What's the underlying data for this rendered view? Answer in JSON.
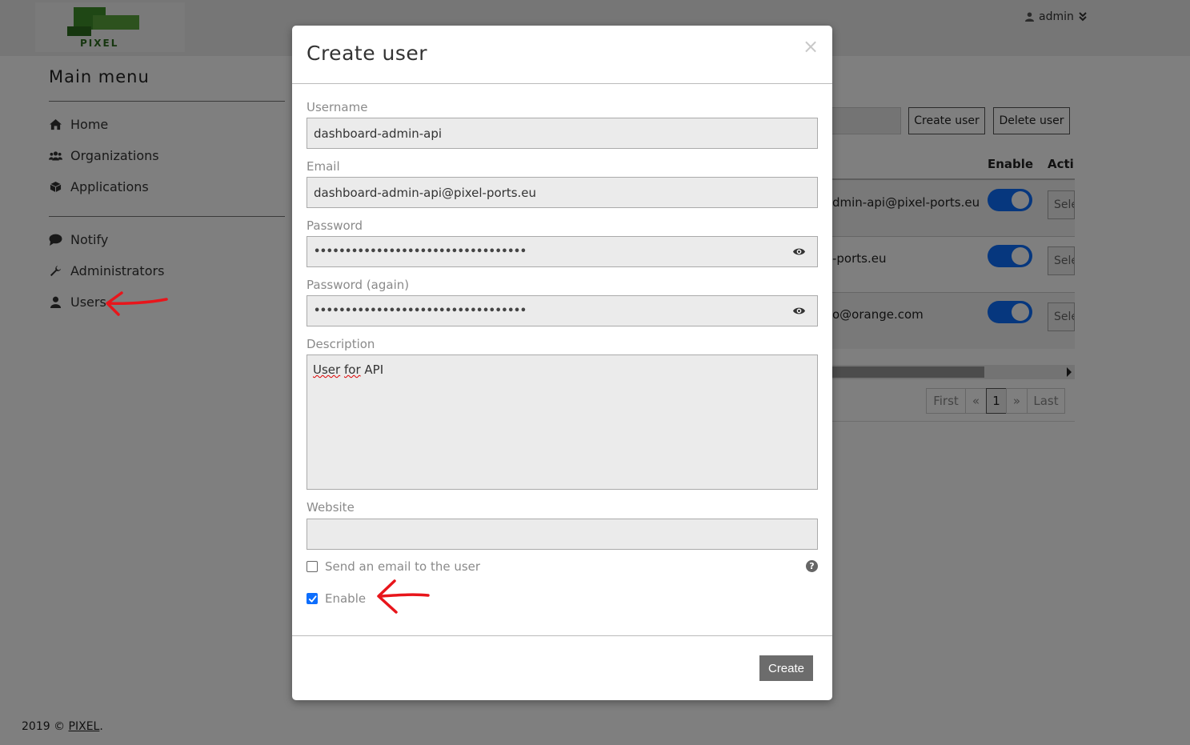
{
  "header": {
    "logo_text": "PIXEL",
    "user_label": "admin"
  },
  "main_menu": {
    "title": "Main menu",
    "items": [
      {
        "label": "Home",
        "icon": "home-icon"
      },
      {
        "label": "Organizations",
        "icon": "users-group-icon"
      },
      {
        "label": "Applications",
        "icon": "cube-icon"
      },
      {
        "label": "Notify",
        "icon": "comment-icon"
      },
      {
        "label": "Administrators",
        "icon": "wrench-icon"
      },
      {
        "label": "Users",
        "icon": "user-icon"
      }
    ]
  },
  "background_table": {
    "create_user_label": "Create user",
    "delete_user_label": "Delete user",
    "col_enable": "Enable",
    "col_actions": "Acti",
    "rows": [
      {
        "email": "dmin-api@pixel-ports.eu",
        "enabled": true,
        "select": "Sele"
      },
      {
        "email": "-ports.eu",
        "enabled": true,
        "select": "Sele"
      },
      {
        "email": "o@orange.com",
        "enabled": true,
        "select": "Sele"
      }
    ],
    "pager": {
      "first": "First",
      "prev": "«",
      "page": "1",
      "next": "»",
      "last": "Last"
    }
  },
  "footer": {
    "text": "2019 © ",
    "link": "PIXEL",
    "suffix": "."
  },
  "modal": {
    "title": "Create user",
    "close": "×",
    "username_label": "Username",
    "username_value": "dashboard-admin-api",
    "email_label": "Email",
    "email_value": "dashboard-admin-api@pixel-ports.eu",
    "password_label": "Password",
    "password_value": "••••••••••••••••••••••••••••••••••",
    "password_again_label": "Password (again)",
    "password_again_value": "••••••••••••••••••••••••••••••••••",
    "description_label": "Description",
    "description_value_word1": "User",
    "description_value_word2": "for",
    "description_value_rest": "API",
    "website_label": "Website",
    "website_value": "",
    "send_email_label": "Send an email to the user",
    "send_email_checked": false,
    "enable_label": "Enable",
    "enable_checked": true,
    "help": "?",
    "create_label": "Create"
  },
  "colors": {
    "accent": "#0d6efd",
    "annotation": "#e8151b",
    "button": "#6c6c6c"
  }
}
